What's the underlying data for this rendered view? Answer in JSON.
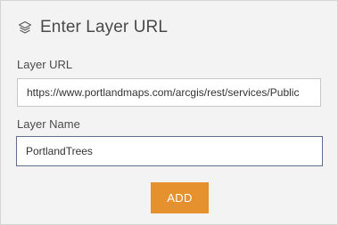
{
  "header": {
    "icon": "layers-icon",
    "title": "Enter Layer URL"
  },
  "form": {
    "layer_url": {
      "label": "Layer URL",
      "value": "https://www.portlandmaps.com/arcgis/rest/services/Public"
    },
    "layer_name": {
      "label": "Layer Name",
      "value": "PortlandTrees"
    },
    "add_label": "ADD"
  },
  "colors": {
    "panel_background": "#f3f3f3",
    "add_button": "#e5912d",
    "focused_input_border": "#5e6f8a"
  }
}
